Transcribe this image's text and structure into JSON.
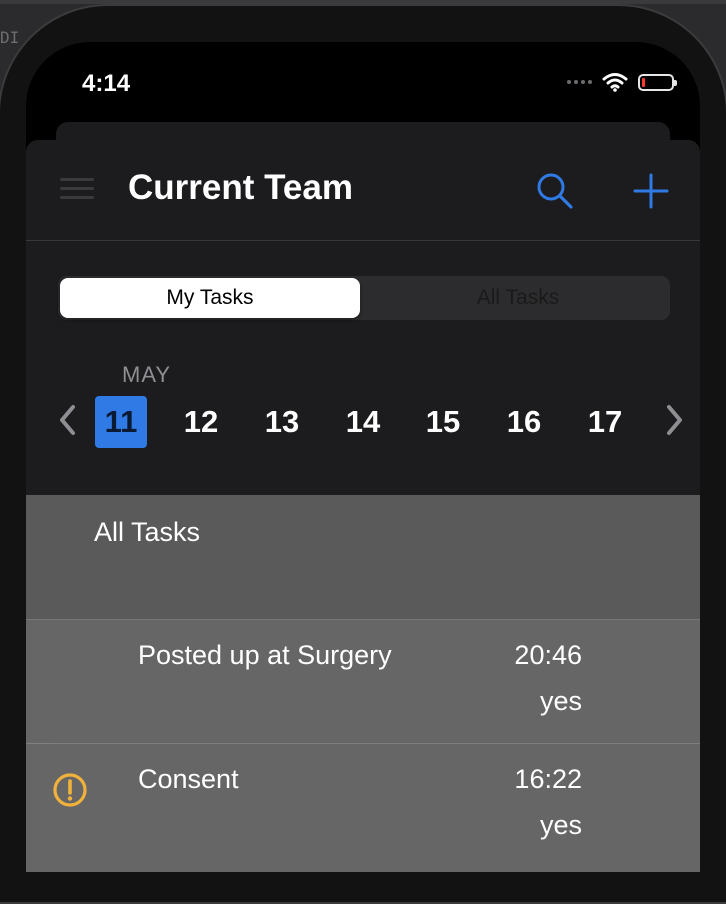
{
  "window": {
    "tag": "DI"
  },
  "status_bar": {
    "time": "4:14",
    "battery_level": 0.1
  },
  "nav": {
    "title": "Current Team"
  },
  "segmented": {
    "options": [
      "My Tasks",
      "All Tasks"
    ],
    "selected": "My Tasks"
  },
  "calendar": {
    "month": "MAY",
    "days": [
      "11",
      "12",
      "13",
      "14",
      "15",
      "16",
      "17"
    ],
    "selected_day": "11"
  },
  "task_list": {
    "section_title": "All Tasks",
    "rows": [
      {
        "title": "Posted up at Surgery",
        "time": "20:46",
        "status": "yes",
        "icon": ""
      },
      {
        "title": "Consent",
        "time": "16:22",
        "status": "yes",
        "icon": "exclamation-circle-icon"
      }
    ]
  },
  "colors": {
    "accent": "#2f7ae5",
    "warning": "#f0b23a",
    "battery_low": "#ff3b30",
    "list_background": "#666666"
  }
}
